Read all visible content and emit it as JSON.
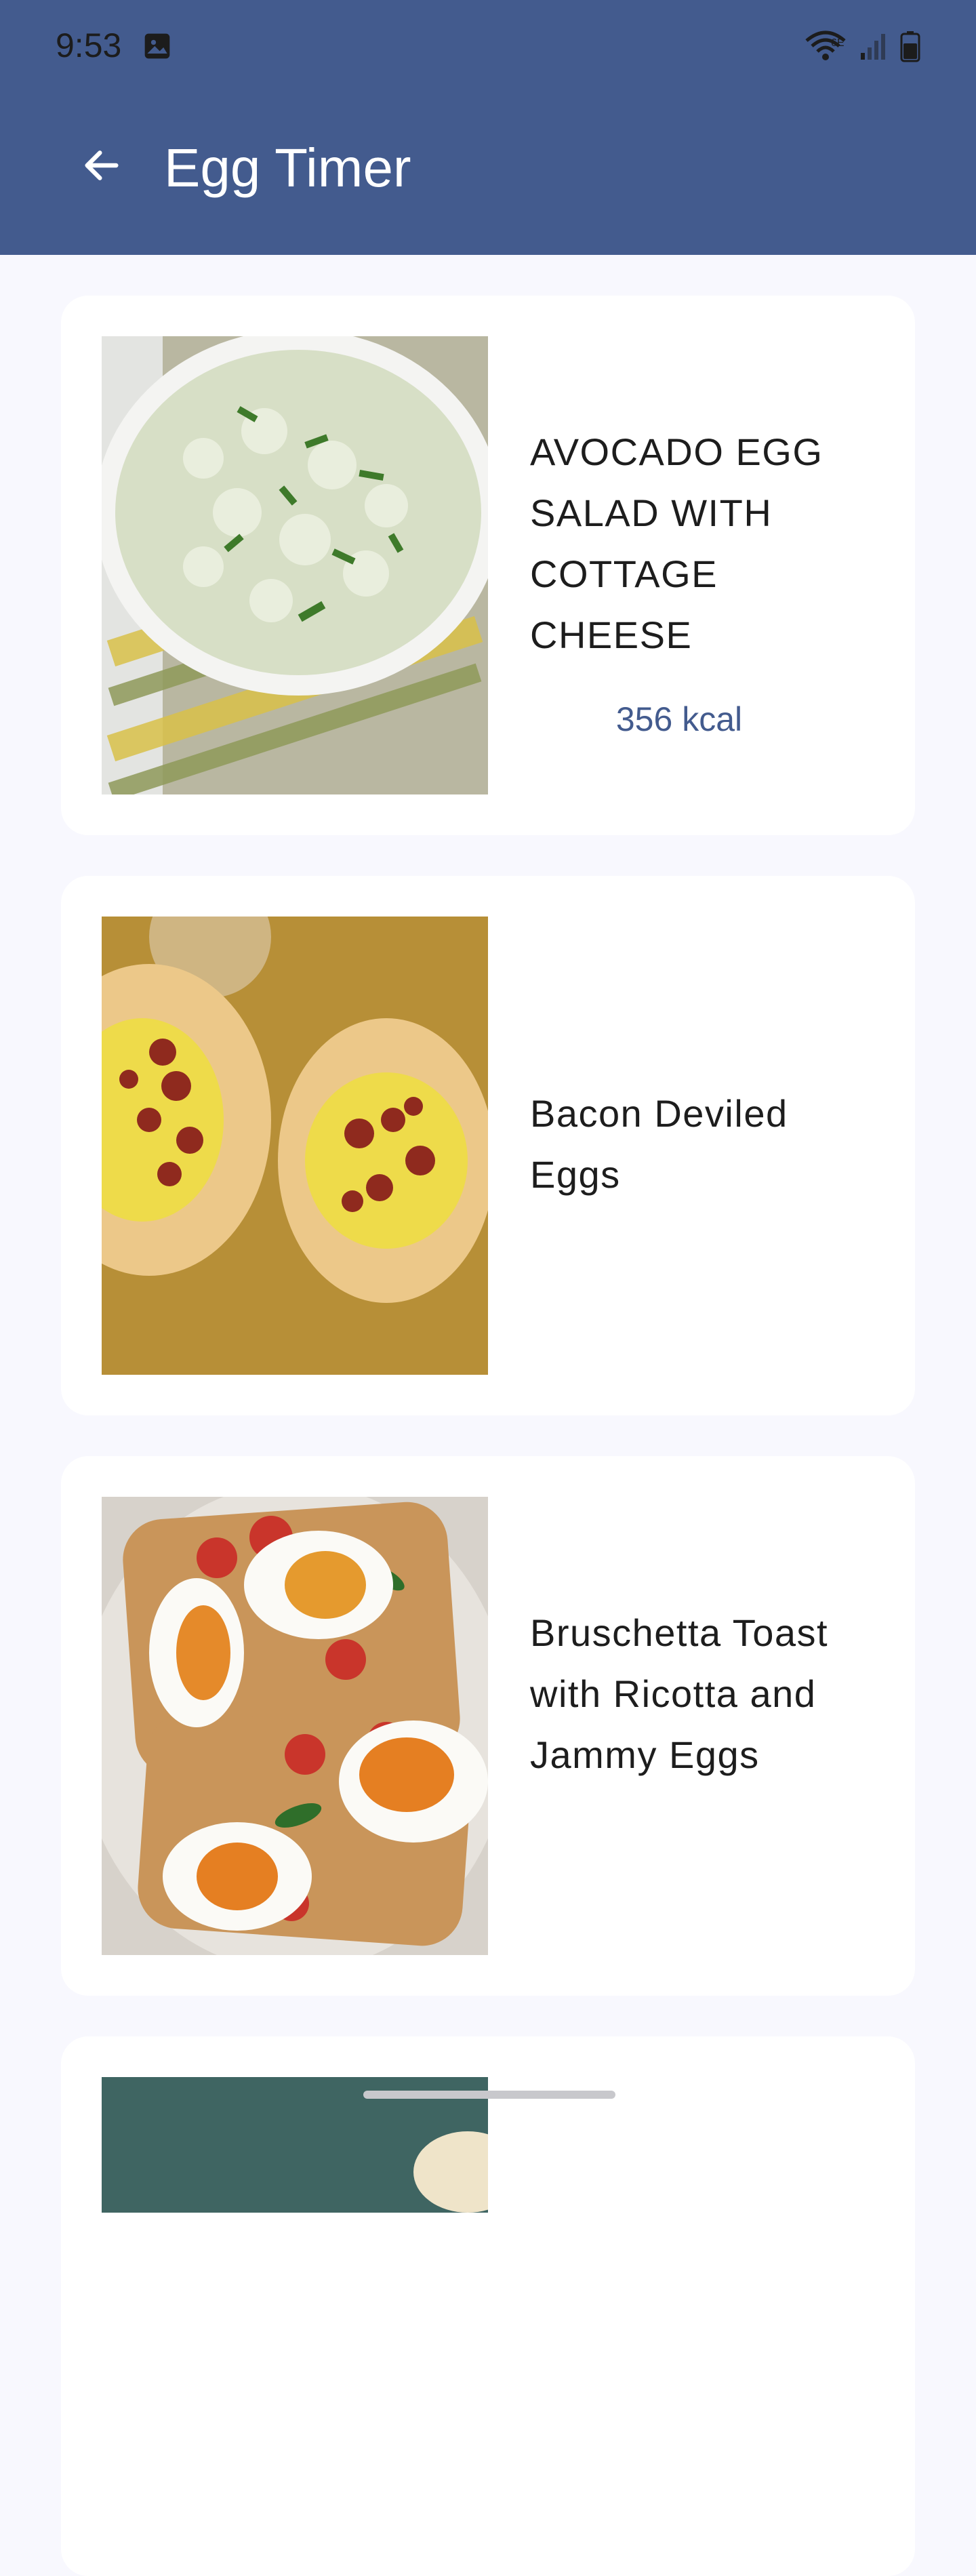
{
  "status_bar": {
    "time": "9:53",
    "icons": [
      "gallery-icon",
      "wifi-6e-icon",
      "cell-signal-icon",
      "battery-icon"
    ]
  },
  "app_bar": {
    "title": "Egg Timer",
    "back_icon": "arrow-left-icon",
    "color": "#435B8E"
  },
  "recipes": [
    {
      "title": "AVOCADO EGG SALAD WITH COTTAGE CHEESE",
      "kcal": "356 kcal",
      "image": "egg-salad-bowl"
    },
    {
      "title": "Bacon Deviled Eggs",
      "kcal": "",
      "image": "deviled-eggs-with-bacon"
    },
    {
      "title": "Bruschetta Toast with Ricotta and Jammy Eggs",
      "kcal": "",
      "image": "toast-with-tomatoes-and-eggs"
    },
    {
      "title": "",
      "kcal": "",
      "image": "partially-visible-recipe"
    }
  ]
}
